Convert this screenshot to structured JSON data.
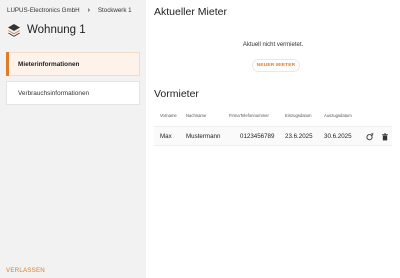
{
  "breadcrumb": {
    "company": "LUPUS-Electronics GmbH",
    "floor": "Stockwerk 1"
  },
  "page_title": "Wohnung 1",
  "nav": [
    {
      "label": "Mieterinformationen",
      "active": true
    },
    {
      "label": "Verbrauchsinformationen",
      "active": false
    }
  ],
  "current_tenant": {
    "title": "Aktueller Mieter",
    "empty_text": "Aktuell nicht vermietet.",
    "new_tenant_label": "NEUER MIETER"
  },
  "landlord": {
    "title": "Vormieter",
    "columns": [
      "Vorname",
      "Nachname",
      "Firma",
      "Telefonnummer",
      "Einzugsdatum",
      "Auszugsdatum"
    ],
    "rows": [
      {
        "first_name": "Max",
        "last_name": "Mustermann",
        "company": "",
        "phone": "0123456789",
        "move_in": "23.6.2025",
        "move_out": "30.6.2025"
      }
    ]
  },
  "leave_label": "VERLASSEN",
  "colors": {
    "accent": "#e07b27",
    "active_bg": "#fdf3ea",
    "sidebar_bg": "#f2f2f2"
  },
  "icons": {
    "logo": "stack-layers-icon",
    "row_action_1": "person-remove-icon",
    "row_action_2": "trash-icon"
  }
}
